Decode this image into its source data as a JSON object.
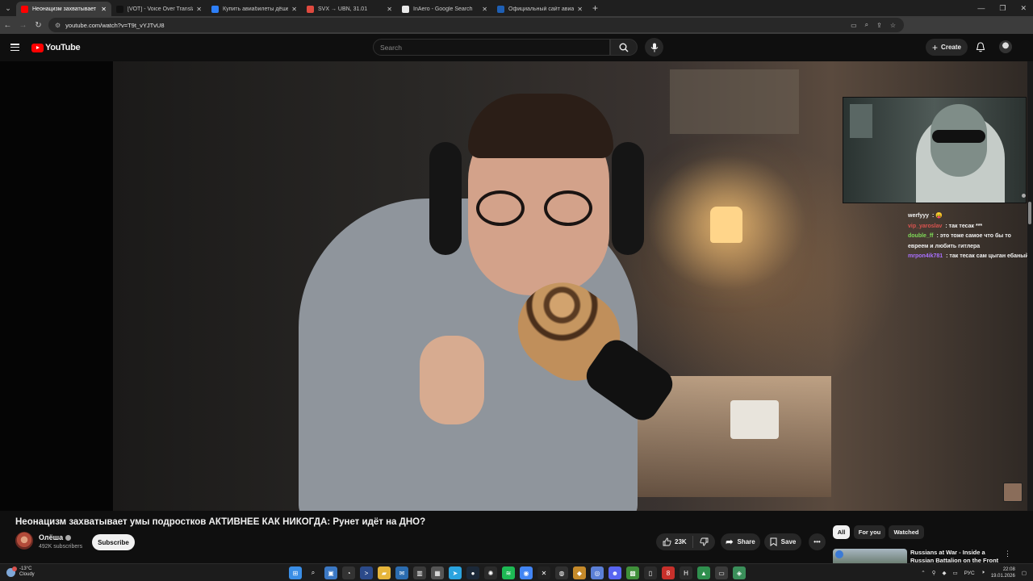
{
  "browser": {
    "tabs": [
      {
        "title": "Неонацизм захватывает умы п",
        "favicon_color": "#ff0000",
        "active": true
      },
      {
        "title": "[VOT] - Voice Over Translation",
        "favicon_color": "#111111",
        "active": false
      },
      {
        "title": "Купить авиабилеты дёшево с",
        "favicon_color": "#2d7ff9",
        "active": false
      },
      {
        "title": "SVX → UBN, 31.01",
        "favicon_color": "#e04a3f",
        "active": false
      },
      {
        "title": "InAero - Google Search",
        "favicon_color": "#e9e9e9",
        "active": false
      },
      {
        "title": "Официальный сайт авиакомп",
        "favicon_color": "#1e5fb4",
        "active": false
      }
    ],
    "tab_menu_icon": "chevron-down-icon",
    "new_tab_icon": "plus-icon",
    "window_controls": [
      "minimize-icon",
      "maximize-icon",
      "close-icon"
    ],
    "url": "youtube.com/watch?v=T9t_vYJTvU8"
  },
  "youtube": {
    "logo_text": "YouTube",
    "search_placeholder": "Search",
    "create_label": "Create",
    "video": {
      "title": "Неонацизм захватывает умы подростков АКТИВНЕЕ КАК НИКОГДА: Рунет идёт на ДНО?",
      "channel_name": "Олёша",
      "subscribers": "492K subscribers",
      "subscribe_label": "Subscribe",
      "likes": "23K",
      "share_label": "Share",
      "save_label": "Save"
    },
    "chat": [
      {
        "user": "werfyyy",
        "user_color": "#f1f1f1",
        "message": "😛"
      },
      {
        "user": "vip_yaroslav",
        "user_color": "#d9534f",
        "message": "так тесак ***"
      },
      {
        "user": "double_ff",
        "user_color": "#7ed957",
        "message": "это тоже самое что бы то евреем и любить гитлера"
      },
      {
        "user": "mrpon4ik781",
        "user_color": "#a970ff",
        "message": "так тесак сам цыган ебаный"
      }
    ],
    "chips": [
      "All",
      "For you",
      "Watched"
    ],
    "recommendation": {
      "title": "Russians at War - Inside a Russian Battalion on the Front"
    }
  },
  "taskbar": {
    "weather_temp": "-13°C",
    "weather_desc": "Cloudy",
    "language": "РУС",
    "time": "22:08",
    "date": "19.01.2026",
    "apps": [
      {
        "name": "windows-start-icon",
        "color": "#3a8ee6",
        "glyph": "⊞"
      },
      {
        "name": "search-icon",
        "color": "#1c1c1c",
        "glyph": "⌕"
      },
      {
        "name": "gallery-icon",
        "color": "#3b78c4",
        "glyph": "▣"
      },
      {
        "name": "app-circle-icon",
        "color": "#333333",
        "glyph": "◔"
      },
      {
        "name": "terminal-icon",
        "color": "#2b4a8a",
        "glyph": ">"
      },
      {
        "name": "folder-icon",
        "color": "#e6b53a",
        "glyph": "▰"
      },
      {
        "name": "mail-icon",
        "color": "#2b6cb0",
        "glyph": "✉"
      },
      {
        "name": "media-icon",
        "color": "#3a3a3a",
        "glyph": "▥"
      },
      {
        "name": "calendar-icon",
        "color": "#555555",
        "glyph": "▦"
      },
      {
        "name": "telegram-icon",
        "color": "#2aa3df",
        "glyph": "➤"
      },
      {
        "name": "steam-icon",
        "color": "#1b2838",
        "glyph": "●"
      },
      {
        "name": "openai-icon",
        "color": "#2b2b2b",
        "glyph": "✺"
      },
      {
        "name": "spotify-icon",
        "color": "#1db954",
        "glyph": "≋"
      },
      {
        "name": "chrome-icon",
        "color": "#4285f4",
        "glyph": "◉"
      },
      {
        "name": "capcut-icon",
        "color": "#222222",
        "glyph": "✕"
      },
      {
        "name": "obs-icon",
        "color": "#303030",
        "glyph": "◍"
      },
      {
        "name": "shield-app-icon",
        "color": "#c58a2a",
        "glyph": "◆"
      },
      {
        "name": "globe-icon",
        "color": "#5b7fd6",
        "glyph": "◎"
      },
      {
        "name": "discord-icon",
        "color": "#5865f2",
        "glyph": "☻"
      },
      {
        "name": "minecraft-icon",
        "color": "#3f8f3a",
        "glyph": "▩"
      },
      {
        "name": "notion-icon",
        "color": "#2b2b2b",
        "glyph": "▯"
      },
      {
        "name": "redapp-icon",
        "color": "#c7302b",
        "glyph": "8"
      },
      {
        "name": "happ-icon",
        "color": "#2b2b2b",
        "glyph": "H"
      },
      {
        "name": "chart-app-icon",
        "color": "#2f8f4e",
        "glyph": "▲"
      },
      {
        "name": "terminal-app-icon",
        "color": "#3a3a3a",
        "glyph": "▭"
      },
      {
        "name": "shield-green-icon",
        "color": "#3a8f5a",
        "glyph": "◈"
      }
    ]
  }
}
